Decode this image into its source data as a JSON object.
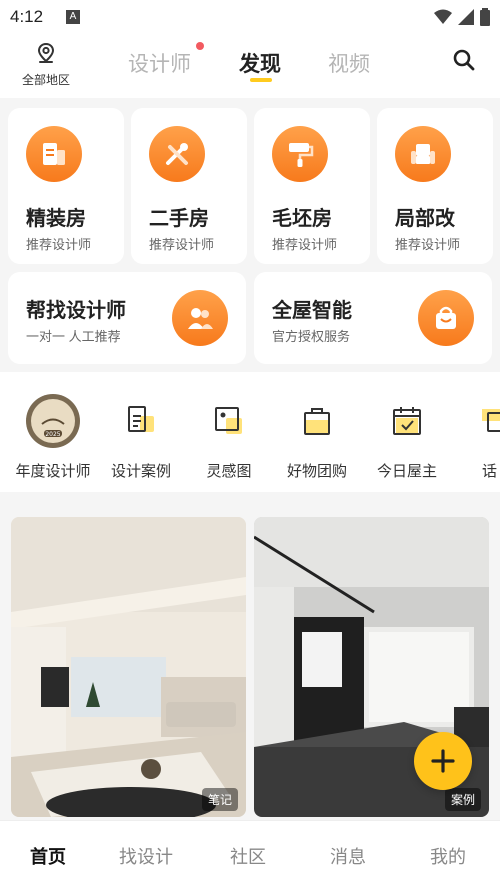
{
  "status": {
    "time": "4:12",
    "notif_letter": "A"
  },
  "header": {
    "location_label": "全部地区",
    "tabs": [
      {
        "label": "设计师"
      },
      {
        "label": "发现"
      },
      {
        "label": "视频"
      }
    ],
    "active_tab": "发现"
  },
  "services": [
    {
      "title": "精装房",
      "sub": "推荐设计师",
      "icon": "document-icon"
    },
    {
      "title": "二手房",
      "sub": "推荐设计师",
      "icon": "tools-icon"
    },
    {
      "title": "毛坯房",
      "sub": "推荐设计师",
      "icon": "paint-roller-icon"
    },
    {
      "title": "局部改",
      "sub": "推荐设计师",
      "icon": "armchair-icon"
    }
  ],
  "promos": [
    {
      "title": "帮找设计师",
      "sub": "一对一 人工推荐",
      "icon": "people-icon"
    },
    {
      "title": "全屋智能",
      "sub": "官方授权服务",
      "icon": "shopping-bag-icon"
    }
  ],
  "shortcuts": [
    {
      "label": "年度设计师",
      "icon": "award-badge-icon",
      "badge_year": "2025"
    },
    {
      "label": "设计案例",
      "icon": "case-file-icon"
    },
    {
      "label": "灵感图",
      "icon": "image-icon"
    },
    {
      "label": "好物团购",
      "icon": "shopping-bag-icon"
    },
    {
      "label": "今日屋主",
      "icon": "calendar-check-icon"
    },
    {
      "label": "话",
      "icon": "topic-icon"
    }
  ],
  "feed": [
    {
      "tag": "笔记"
    },
    {
      "tag": "案例"
    }
  ],
  "bottom_nav": [
    {
      "label": "首页"
    },
    {
      "label": "找设计"
    },
    {
      "label": "社区"
    },
    {
      "label": "消息"
    },
    {
      "label": "我的"
    }
  ],
  "colors": {
    "accent": "#ffcb1f",
    "orange": "#f77a1c"
  }
}
